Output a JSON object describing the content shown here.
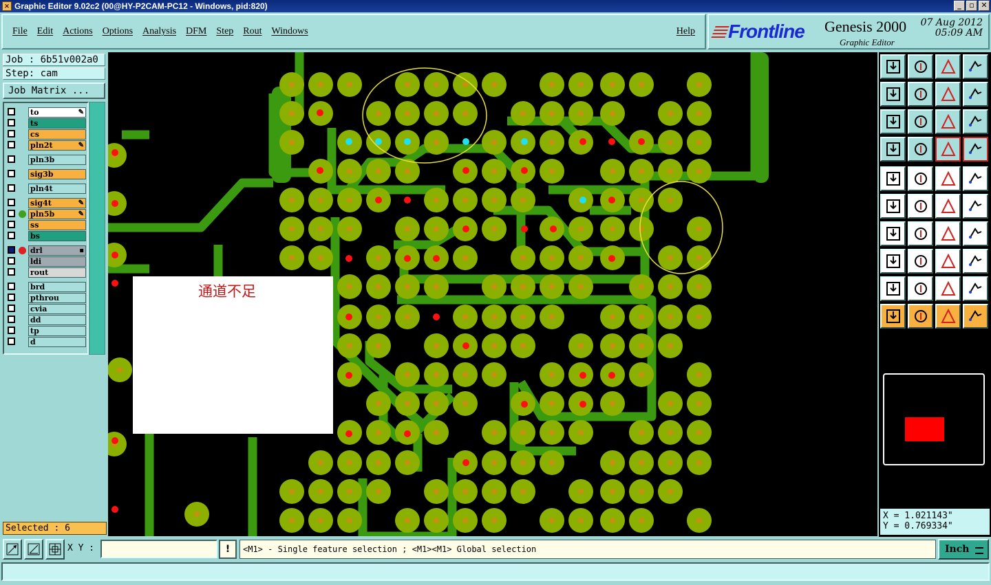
{
  "window": {
    "title": "Graphic Editor 9.02c2 (00@HY-P2CAM-PC12 - Windows, pid:820)"
  },
  "menu": {
    "items": [
      "File",
      "Edit",
      "Actions",
      "Options",
      "Analysis",
      "DFM",
      "Step",
      "Rout",
      "Windows"
    ],
    "help": "Help"
  },
  "brand": {
    "logo": "Frontline",
    "product": "Genesis 2000",
    "subtitle": "Graphic Editor",
    "date": "07 Aug 2012",
    "time": "05:09 AM"
  },
  "job": {
    "job_label": "Job : 6b51v002a0",
    "step_label": "Step: cam",
    "matrix_button": "Job Matrix ..."
  },
  "layers": [
    {
      "name": "to",
      "color": "#ffffff",
      "mark": "✎",
      "dot": ""
    },
    {
      "name": "ts",
      "color": "#20a080",
      "mark": "",
      "dot": ""
    },
    {
      "name": "cs",
      "color": "#f8b040",
      "mark": "",
      "dot": ""
    },
    {
      "name": "pln2t",
      "color": "#f8b040",
      "mark": "✎",
      "dot": ""
    },
    {
      "name": "pln3b",
      "color": "#a8dedc",
      "mark": "",
      "dot": ""
    },
    {
      "name": "sig3b",
      "color": "#f8b040",
      "mark": "",
      "dot": ""
    },
    {
      "name": "pln4t",
      "color": "#a8dedc",
      "mark": "",
      "dot": ""
    },
    {
      "name": "sig4t",
      "color": "#f8b040",
      "mark": "✎",
      "dot": ""
    },
    {
      "name": "pln5b",
      "color": "#f8b040",
      "mark": "✎",
      "dot": "#40a020"
    },
    {
      "name": "ss",
      "color": "#f8b040",
      "mark": "",
      "dot": ""
    },
    {
      "name": "bs",
      "color": "#20a080",
      "mark": "",
      "dot": ""
    },
    {
      "name": "drl",
      "color": "#a0a8b0",
      "mark": "▪",
      "dot": "#e02020"
    },
    {
      "name": "ldi",
      "color": "#a0a8b0",
      "mark": "",
      "dot": ""
    },
    {
      "name": "rout",
      "color": "#d8d8d8",
      "mark": "",
      "dot": ""
    },
    {
      "name": "brd",
      "color": "#a8dedc",
      "mark": "",
      "dot": ""
    },
    {
      "name": "pthrou",
      "color": "#a8dedc",
      "mark": "",
      "dot": ""
    },
    {
      "name": "cvia",
      "color": "#a8dedc",
      "mark": "",
      "dot": ""
    },
    {
      "name": "dd",
      "color": "#a8dedc",
      "mark": "",
      "dot": ""
    },
    {
      "name": "tp",
      "color": "#a8dedc",
      "mark": "",
      "dot": ""
    },
    {
      "name": "d",
      "color": "#a8dedc",
      "mark": "",
      "dot": ""
    }
  ],
  "selected": "Selected : 6",
  "annotation": "通道不足",
  "coords": {
    "x": "X = 1.021143\"",
    "y": "Y = 0.769334\""
  },
  "bottom": {
    "xy_label": "X Y :",
    "xy_value": "",
    "warn": "!",
    "prompt": "<M1> - Single feature selection ; <M1><M1> Global selection",
    "units": "Inch"
  },
  "colors": {
    "copper": "#3c9a10",
    "pad": "#8cb000",
    "via_red": "#ff1010",
    "via_cyan": "#20e0f0",
    "highlight": "#e8e040"
  },
  "tool_icons": [
    "zoom-home-icon",
    "zoom-down-icon",
    "home-icon",
    "split-icon",
    "pan-left-icon",
    "pan-right-icon",
    "undo-zoom-icon",
    "redraw-icon",
    "fit-icon",
    "center-icon",
    "scale-1-2-icon",
    "query-icon",
    "settings-icon",
    "grid-icon",
    "layers-a-icon",
    "layers-b-icon",
    "snap-icon",
    "measure-icon",
    "ruler-icon",
    "point-icon",
    "connect-icon",
    "delete-icon",
    "line-icon",
    "arc-icon",
    "angle-icon",
    "edit-line-icon",
    "rotate-icon",
    "flip-icon",
    "pad-icon",
    "cut-icon",
    "resize-icon",
    "group-icon",
    "poly-icon",
    "arrow-poly-icon",
    "route-icon",
    "align-icon",
    "select-icon",
    "select-box-icon",
    "select-poly-icon",
    "select-net-icon"
  ]
}
